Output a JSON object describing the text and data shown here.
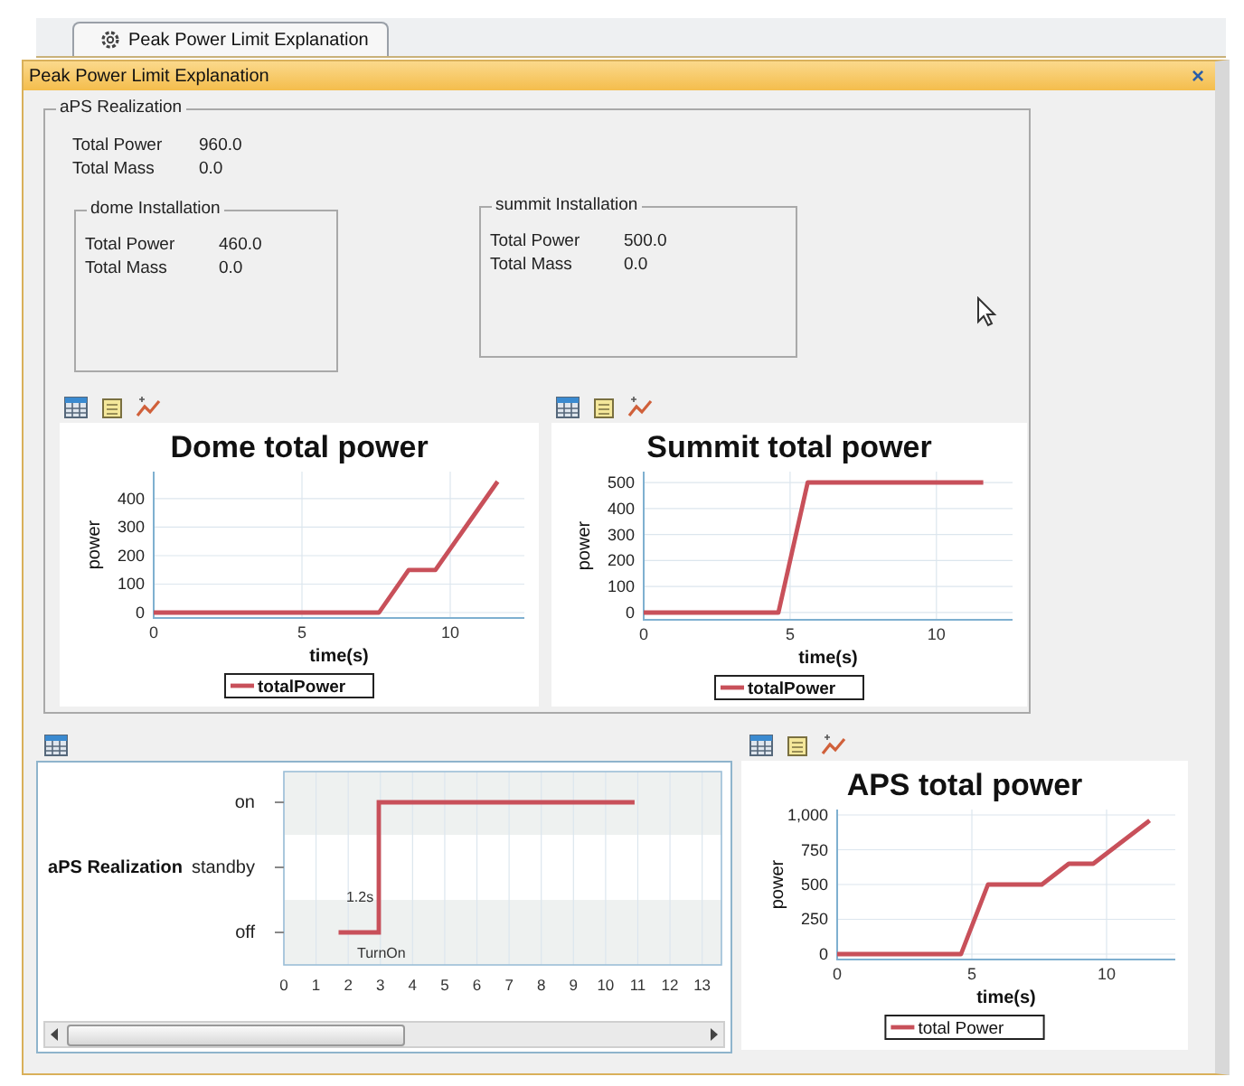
{
  "tab": {
    "label": "Peak Power Limit Explanation",
    "selected": true
  },
  "panel": {
    "title": "Peak Power Limit Explanation",
    "close": "×"
  },
  "realization": {
    "title": "aPS Realization",
    "properties": [
      {
        "label": "Total Power",
        "value": "960.0"
      },
      {
        "label": "Total Mass",
        "value": "0.0"
      }
    ],
    "installations": [
      {
        "title": "dome Installation",
        "properties": [
          {
            "label": "Total Power",
            "value": "460.0"
          },
          {
            "label": "Total Mass",
            "value": "0.0"
          }
        ]
      },
      {
        "title": "summit Installation",
        "properties": [
          {
            "label": "Total Power",
            "value": "500.0"
          },
          {
            "label": "Total Mass",
            "value": "0.0"
          }
        ]
      }
    ],
    "charts": [
      {
        "kind": "plot",
        "chart_data": {
          "type": "line",
          "title": "Dome total power",
          "xlabel": "time(s)",
          "ylabel": "power",
          "x": [
            0,
            7.6,
            8.6,
            9.5,
            11.6
          ],
          "series": [
            {
              "name": "totalPower",
              "color": "#c8505a",
              "values": [
                0,
                0,
                150,
                150,
                460
              ]
            }
          ],
          "xlim": [
            0,
            12.5
          ],
          "ylim": [
            -19,
            495
          ],
          "xticks": [
            0,
            5,
            10
          ],
          "yticks": [
            0,
            100,
            200,
            300,
            400
          ],
          "grid": true
        }
      },
      {
        "kind": "plot",
        "chart_data": {
          "type": "line",
          "title": "Summit total power",
          "xlabel": "time(s)",
          "ylabel": "power",
          "x": [
            0,
            4.6,
            5.6,
            11.6
          ],
          "series": [
            {
              "name": "totalPower",
              "color": "#c8505a",
              "values": [
                0,
                0,
                500,
                500
              ]
            }
          ],
          "xlim": [
            0,
            12.6
          ],
          "ylim": [
            -28,
            542
          ],
          "xticks": [
            0,
            5,
            10
          ],
          "yticks": [
            0,
            100,
            200,
            300,
            400,
            500
          ],
          "grid": true
        }
      }
    ]
  },
  "timeline": {
    "kind": "timeline",
    "lane": "aPS Realization",
    "states": [
      "on",
      "standby",
      "off"
    ],
    "time_ticks": [
      "0",
      "1",
      "2",
      "3",
      "4",
      "5",
      "6",
      "7",
      "8",
      "9",
      "10",
      "11",
      "12",
      "13"
    ],
    "annotations": [
      "1.2s",
      "TurnOn"
    ]
  },
  "aps": {
    "kind": "plot",
    "chart_data": {
      "type": "line",
      "title": "APS total power",
      "xlabel": "time(s)",
      "ylabel": "power",
      "x": [
        0,
        4.6,
        5.6,
        7.6,
        8.6,
        9.5,
        11.6
      ],
      "series": [
        {
          "name": "total Power",
          "color": "#c8505a",
          "values": [
            0,
            0,
            500,
            500,
            650,
            650,
            960
          ]
        }
      ],
      "xlim": [
        0,
        12.55
      ],
      "ylim": [
        -39,
        1039
      ],
      "xticks": [
        0,
        5,
        10
      ],
      "yticks": [
        0,
        250,
        500,
        750,
        {
          "value": 1000,
          "label": "1,000"
        }
      ],
      "grid": true
    }
  }
}
